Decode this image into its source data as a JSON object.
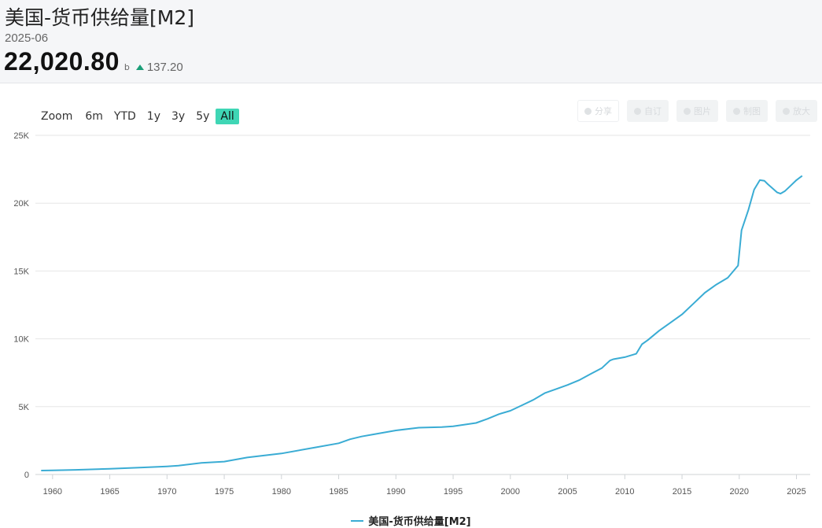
{
  "header": {
    "title": "美国-货币供给量[M2]",
    "date": "2025-06",
    "value": "22,020.80",
    "unit": "b",
    "change": "137.20"
  },
  "zoom": {
    "label": "Zoom",
    "buttons": [
      "6m",
      "YTD",
      "1y",
      "3y",
      "5y",
      "All"
    ],
    "active": "All"
  },
  "tools": [
    "分享",
    "自订",
    "图片",
    "制图",
    "放大"
  ],
  "colors": {
    "line": "#3aacd4",
    "up": "#1a9e78",
    "active_zoom": "#3fd6b5"
  },
  "chart_data": {
    "type": "line",
    "title": "",
    "xlabel": "",
    "ylabel": "",
    "xlim": [
      1958.5,
      2026.2
    ],
    "ylim": [
      0,
      25000
    ],
    "yticks": [
      0,
      5000,
      10000,
      15000,
      20000,
      25000
    ],
    "ytick_labels": [
      "0",
      "5K",
      "10K",
      "15K",
      "20K",
      "25K"
    ],
    "xticks": [
      1960,
      1965,
      1970,
      1975,
      1980,
      1985,
      1990,
      1995,
      2000,
      2005,
      2010,
      2015,
      2020,
      2025
    ],
    "grid": true,
    "legend": "bottom-center",
    "series": [
      {
        "name": "美国-货币供给量[M2]",
        "x": [
          1959.0,
          1960.0,
          1962.0,
          1965.0,
          1968.0,
          1970.0,
          1971.0,
          1973.0,
          1975.0,
          1977.0,
          1980.0,
          1983.0,
          1985.0,
          1986.0,
          1987.0,
          1988.0,
          1990.0,
          1992.0,
          1994.0,
          1995.0,
          1997.0,
          1998.0,
          1999.0,
          2000.0,
          2001.0,
          2002.0,
          2003.0,
          2004.0,
          2005.0,
          2006.0,
          2007.0,
          2008.0,
          2008.7,
          2009.0,
          2010.0,
          2011.0,
          2011.5,
          2012.0,
          2013.0,
          2014.0,
          2015.0,
          2016.0,
          2017.0,
          2018.0,
          2019.0,
          2019.9,
          2020.2,
          2020.4,
          2020.8,
          2021.3,
          2021.8,
          2022.2,
          2022.5,
          2022.9,
          2023.3,
          2023.6,
          2024.0,
          2024.5,
          2025.0,
          2025.5
        ],
        "values": [
          290,
          310,
          340,
          420,
          520,
          600,
          650,
          850,
          950,
          1250,
          1550,
          2000,
          2300,
          2600,
          2800,
          2950,
          3250,
          3450,
          3500,
          3550,
          3800,
          4100,
          4450,
          4700,
          5100,
          5500,
          6000,
          6300,
          6600,
          6950,
          7400,
          7850,
          8400,
          8500,
          8650,
          8900,
          9600,
          9900,
          10600,
          11200,
          11800,
          12600,
          13400,
          14000,
          14500,
          15400,
          18000,
          18500,
          19500,
          21000,
          21700,
          21650,
          21400,
          21100,
          20800,
          20700,
          20900,
          21300,
          21700,
          22020.8
        ]
      }
    ]
  }
}
